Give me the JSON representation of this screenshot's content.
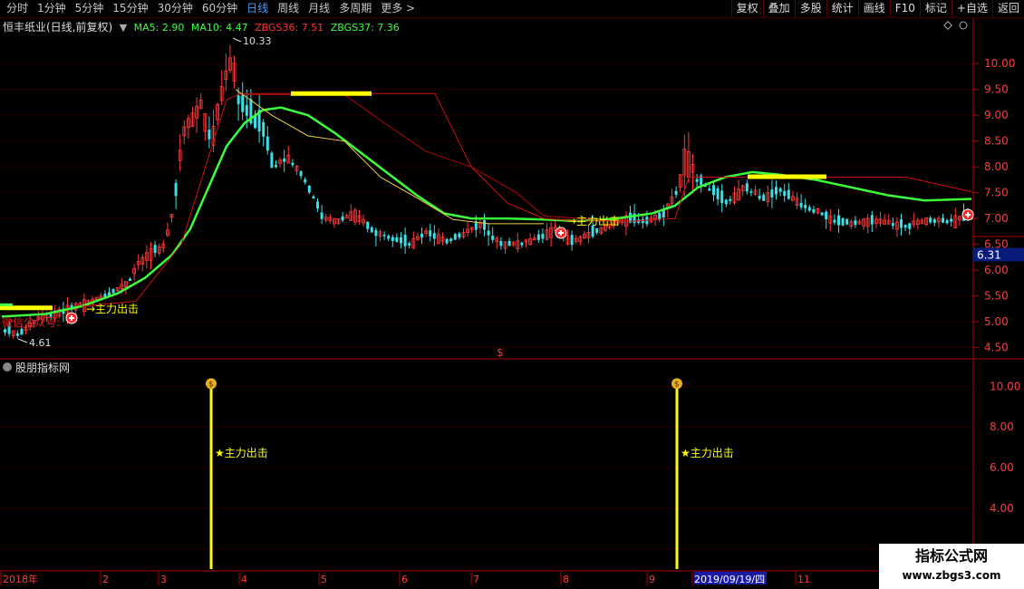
{
  "toolbar": {
    "tabs": [
      "分时",
      "1分钟",
      "5分钟",
      "15分钟",
      "30分钟",
      "60分钟",
      "日线",
      "周线",
      "月线",
      "多周期",
      "更多 >"
    ],
    "active_tab": "日线",
    "tools": [
      "复权",
      "叠加",
      "多股",
      "统计",
      "画线",
      "F10",
      "标记",
      "+自选",
      "返回"
    ]
  },
  "info": {
    "stock": "恒丰纸业(日线,前复权)",
    "ma5": "MA5: 2.90",
    "ma10": "MA10: 4.47",
    "zbgs36": "ZBGS36: 7.51",
    "zbgs37": "ZBGS37: 7.36"
  },
  "colors": {
    "ma5": "#ffffff",
    "zbgs36": "#ff3030",
    "zbgs37": "#3cff3c",
    "label_green": "#3cff3c",
    "up": "#ff3a3a",
    "down": "#38e0e8",
    "yellow": "#ffff00"
  },
  "main_labels": {
    "high": "10.33",
    "low": "4.61",
    "signal": "主力出击",
    "current_price": "6.31",
    "weixin": "微信公众号:",
    "dollar": "$"
  },
  "sub_panel": {
    "title": "股朋指标网",
    "signal": "★主力出击"
  },
  "x_labels": [
    "2018年",
    "2",
    "3",
    "4",
    "5",
    "6",
    "7",
    "8",
    "9",
    "2019/09/19/四",
    "11"
  ],
  "watermark": {
    "line1": "指标公式网",
    "line2": "www.zbgs3.com"
  },
  "chart_data": [
    {
      "type": "candlestick",
      "title": "恒丰纸业(日线,前复权)",
      "ylim": [
        4.3,
        10.6
      ],
      "y_ticks": [
        4.5,
        5.0,
        5.5,
        6.0,
        6.5,
        7.0,
        7.5,
        8.0,
        8.5,
        9.0,
        9.5,
        10.0
      ],
      "high": 10.33,
      "low": 4.61,
      "current": 6.31,
      "series": [
        {
          "name": "MA5",
          "value": 2.9
        },
        {
          "name": "MA10",
          "value": 4.47
        },
        {
          "name": "ZBGS36",
          "value": 7.51
        },
        {
          "name": "ZBGS37",
          "value": 7.36
        }
      ],
      "annotations": [
        "主力出击",
        "主力出击"
      ]
    },
    {
      "type": "bar",
      "title": "股朋指标网",
      "ylim": [
        1,
        11
      ],
      "y_ticks": [
        2.0,
        4.0,
        6.0,
        8.0,
        10.0
      ],
      "signals": [
        {
          "label": "★主力出击",
          "value": 10
        },
        {
          "label": "★主力出击",
          "value": 10
        }
      ]
    }
  ]
}
